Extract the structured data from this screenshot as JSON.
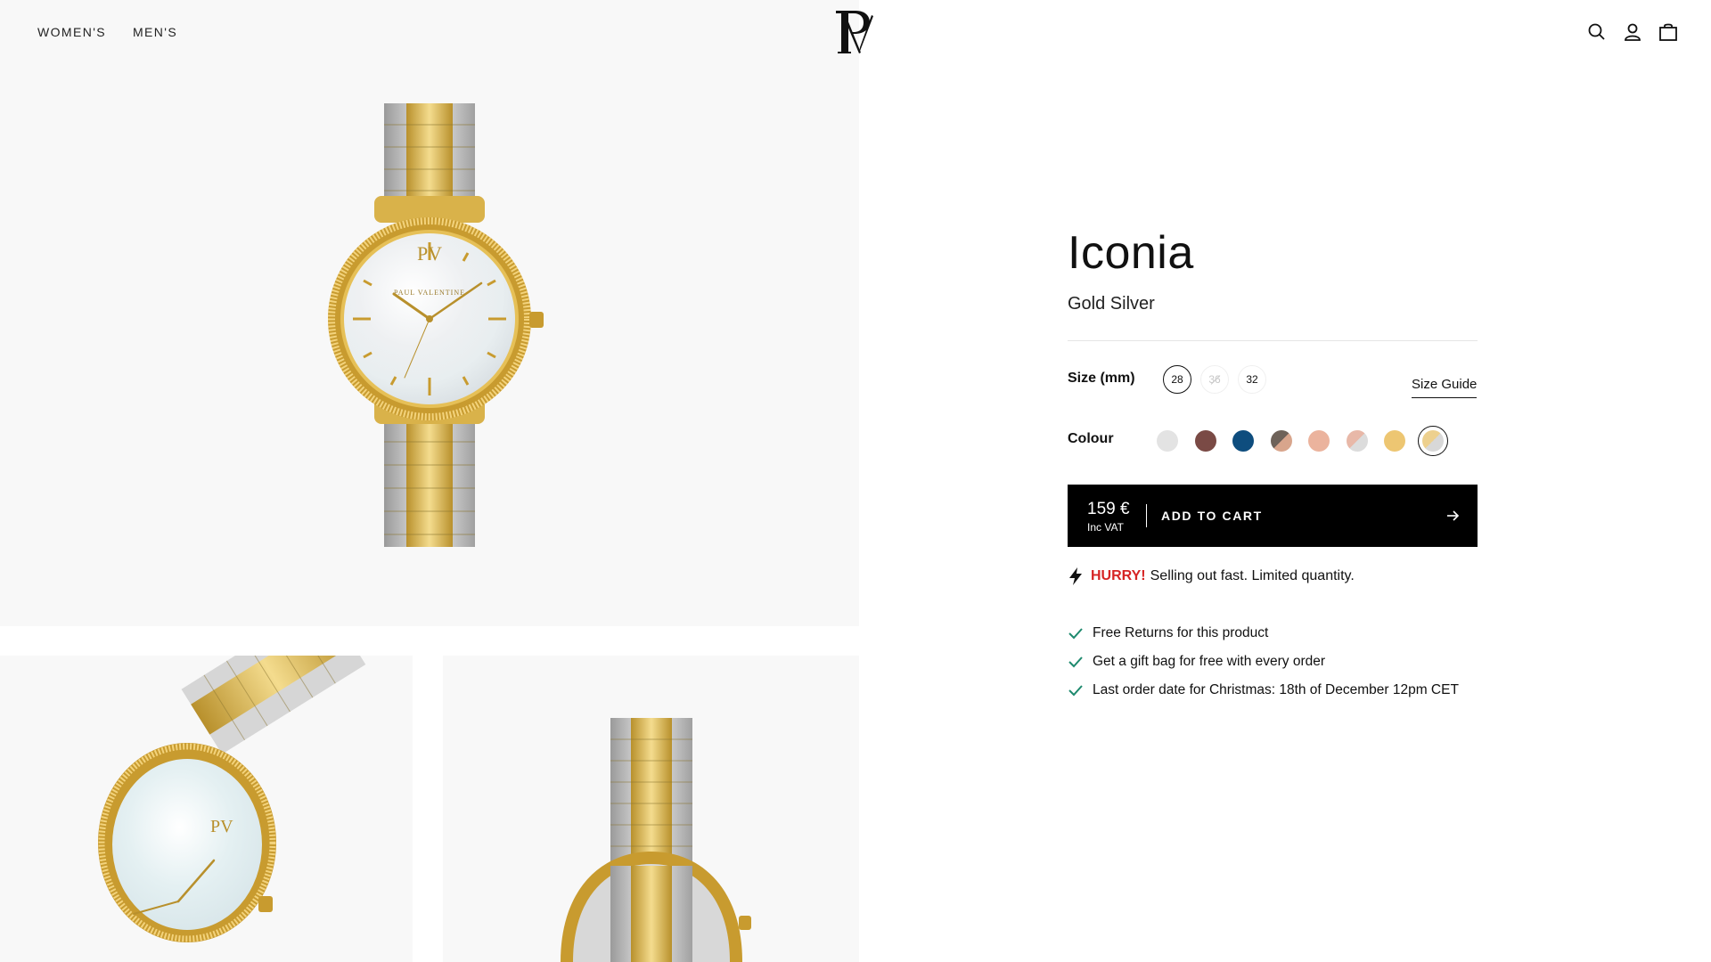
{
  "nav": {
    "women": "WOMEN'S",
    "men": "MEN'S"
  },
  "header_icons": [
    "search-icon",
    "account-icon",
    "bag-icon"
  ],
  "brand": {
    "logo_letters": "PV",
    "watch_dial_text": "PAUL VALENTINE"
  },
  "product": {
    "title": "Iconia",
    "subtitle": "Gold Silver"
  },
  "size": {
    "label": "Size (mm)",
    "options": [
      "28",
      "36",
      "32"
    ],
    "selected": "28",
    "unavailable": [
      "36"
    ],
    "guide_label": "Size Guide"
  },
  "colour": {
    "label": "Colour",
    "swatches": [
      {
        "name": "silver",
        "color": "#e3e3e3"
      },
      {
        "name": "mocha",
        "color": "#7a4a45"
      },
      {
        "name": "navy",
        "color": "#0e4d7e"
      },
      {
        "name": "gunmetal-rose",
        "color": "#6e6259",
        "color2": "#d8a58c"
      },
      {
        "name": "rose",
        "color": "#ebb39d"
      },
      {
        "name": "rose-silver",
        "color": "#e8b8a8",
        "color2": "#dcdcdc"
      },
      {
        "name": "gold",
        "color": "#edc672"
      },
      {
        "name": "gold-silver",
        "color": "#edd08e",
        "color2": "#d8d8d8",
        "selected": true
      }
    ]
  },
  "cart": {
    "price": "159 €",
    "vat": "Inc VAT",
    "label": "ADD TO CART"
  },
  "urgency": {
    "highlight": "HURRY!",
    "text": "Selling out fast. Limited quantity."
  },
  "perks": [
    "Free Returns for this product",
    "Get a gift bag for free with every order",
    "Last order date for Christmas: 18th of December 12pm CET"
  ]
}
